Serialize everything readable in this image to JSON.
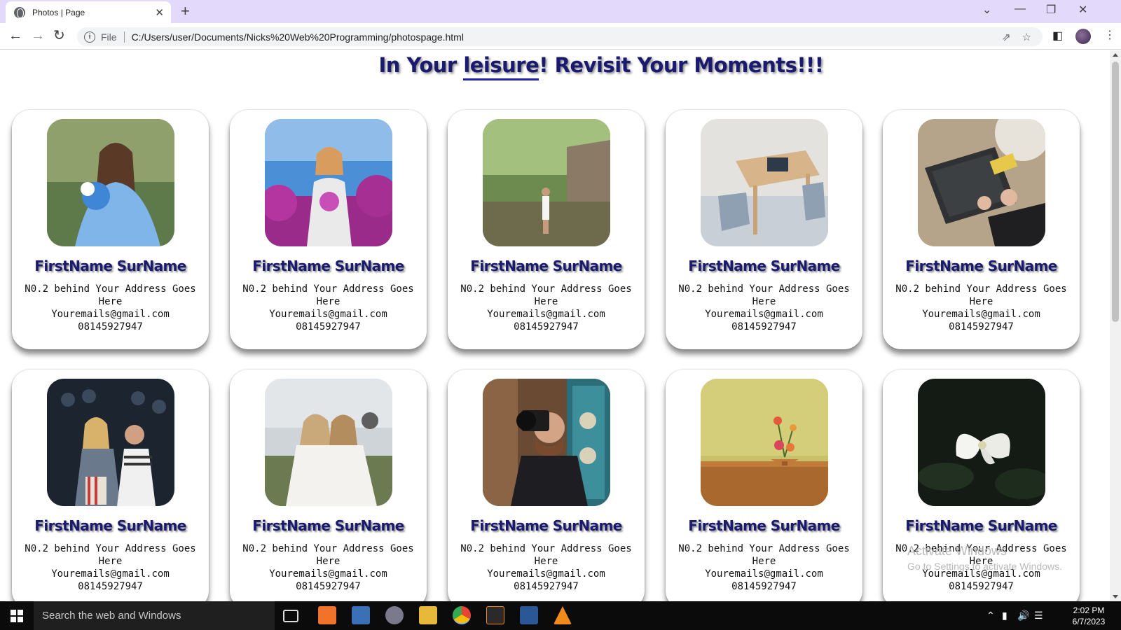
{
  "browser": {
    "tab_title": "Photos | Page",
    "tab_close": "✕",
    "new_tab": "+",
    "address_scheme": "File",
    "address_url": "C:/Users/user/Documents/Nicks%20Web%20Programming/photospage.html",
    "window_controls": [
      "⌄",
      "—",
      "❐",
      "✕"
    ]
  },
  "page": {
    "heading_pre": "In Your ",
    "heading_underlined": "leisure",
    "heading_post": "! Revisit Your Moments!!!",
    "cards": [
      {
        "name": "FirstName SurName",
        "address": "N0.2 behind Your Address Goes Here",
        "email": "Youremails@gmail.com",
        "phone": "08145927947",
        "photo": "girl-blue-gown"
      },
      {
        "name": "FirstName SurName",
        "address": "N0.2 behind Your Address Goes Here",
        "email": "Youremails@gmail.com",
        "phone": "08145927947",
        "photo": "woman-lilac-flowers"
      },
      {
        "name": "FirstName SurName",
        "address": "N0.2 behind Your Address Goes Here",
        "email": "Youremails@gmail.com",
        "phone": "08145927947",
        "photo": "woman-in-river"
      },
      {
        "name": "FirstName SurName",
        "address": "N0.2 behind Your Address Goes Here",
        "email": "Youremails@gmail.com",
        "phone": "08145927947",
        "photo": "table-with-tablet"
      },
      {
        "name": "FirstName SurName",
        "address": "N0.2 behind Your Address Goes Here",
        "email": "Youremails@gmail.com",
        "phone": "08145927947",
        "photo": "laptop-on-rug"
      },
      {
        "name": "FirstName SurName",
        "address": "N0.2 behind Your Address Goes Here",
        "email": "Youremails@gmail.com",
        "phone": "08145927947",
        "photo": "cinema-audience"
      },
      {
        "name": "FirstName SurName",
        "address": "N0.2 behind Your Address Goes Here",
        "email": "Youremails@gmail.com",
        "phone": "08145927947",
        "photo": "two-women-lying"
      },
      {
        "name": "FirstName SurName",
        "address": "N0.2 behind Your Address Goes Here",
        "email": "Youremails@gmail.com",
        "phone": "08145927947",
        "photo": "photographer-camera"
      },
      {
        "name": "FirstName SurName",
        "address": "N0.2 behind Your Address Goes Here",
        "email": "Youremails@gmail.com",
        "phone": "08145927947",
        "photo": "flower-bowl-table"
      },
      {
        "name": "FirstName SurName",
        "address": "N0.2 behind Your Address Goes Here",
        "email": "Youremails@gmail.com",
        "phone": "08145927947",
        "photo": "white-flower-dark"
      }
    ]
  },
  "watermark": {
    "line1": "Activate Windows",
    "line2": "Go to Settings to activate Windows."
  },
  "taskbar": {
    "search_placeholder": "Search the web and Windows",
    "time": "2:02 PM",
    "date": "6/7/2023"
  }
}
